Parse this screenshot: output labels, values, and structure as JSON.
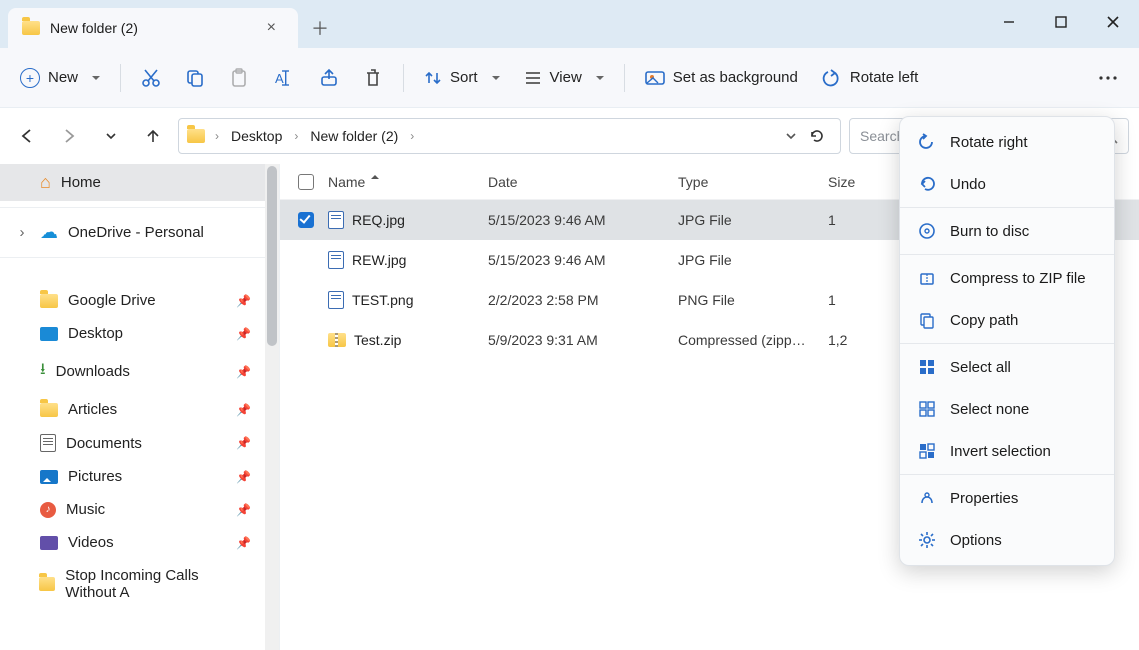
{
  "titlebar": {
    "tab_title": "New folder (2)"
  },
  "toolbar": {
    "new_label": "New",
    "sort_label": "Sort",
    "view_label": "View",
    "set_bg_label": "Set as background",
    "rotate_left_label": "Rotate left"
  },
  "breadcrumb": {
    "items": [
      "Desktop",
      "New folder (2)"
    ]
  },
  "search": {
    "placeholder": "Search"
  },
  "sidebar": {
    "home": "Home",
    "onedrive": "OneDrive - Personal",
    "items": [
      "Google Drive",
      "Desktop",
      "Downloads",
      "Articles",
      "Documents",
      "Pictures",
      "Music",
      "Videos",
      "Stop Incoming Calls Without A"
    ]
  },
  "columns": {
    "name": "Name",
    "date": "Date",
    "type": "Type",
    "size": "Size"
  },
  "files": [
    {
      "name": "REQ.jpg",
      "date": "5/15/2023 9:46 AM",
      "type": "JPG File",
      "size": "1",
      "icon": "file",
      "selected": true
    },
    {
      "name": "REW.jpg",
      "date": "5/15/2023 9:46 AM",
      "type": "JPG File",
      "size": "",
      "icon": "file",
      "selected": false
    },
    {
      "name": "TEST.png",
      "date": "2/2/2023 2:58 PM",
      "type": "PNG File",
      "size": "1",
      "icon": "file",
      "selected": false
    },
    {
      "name": "Test.zip",
      "date": "5/9/2023 9:31 AM",
      "type": "Compressed (zipp…",
      "size": "1,2",
      "icon": "zip",
      "selected": false
    }
  ],
  "menu": {
    "rotate_right": "Rotate right",
    "undo": "Undo",
    "burn": "Burn to disc",
    "compress": "Compress to ZIP file",
    "copy_path": "Copy path",
    "select_all": "Select all",
    "select_none": "Select none",
    "invert": "Invert selection",
    "properties": "Properties",
    "options": "Options"
  }
}
